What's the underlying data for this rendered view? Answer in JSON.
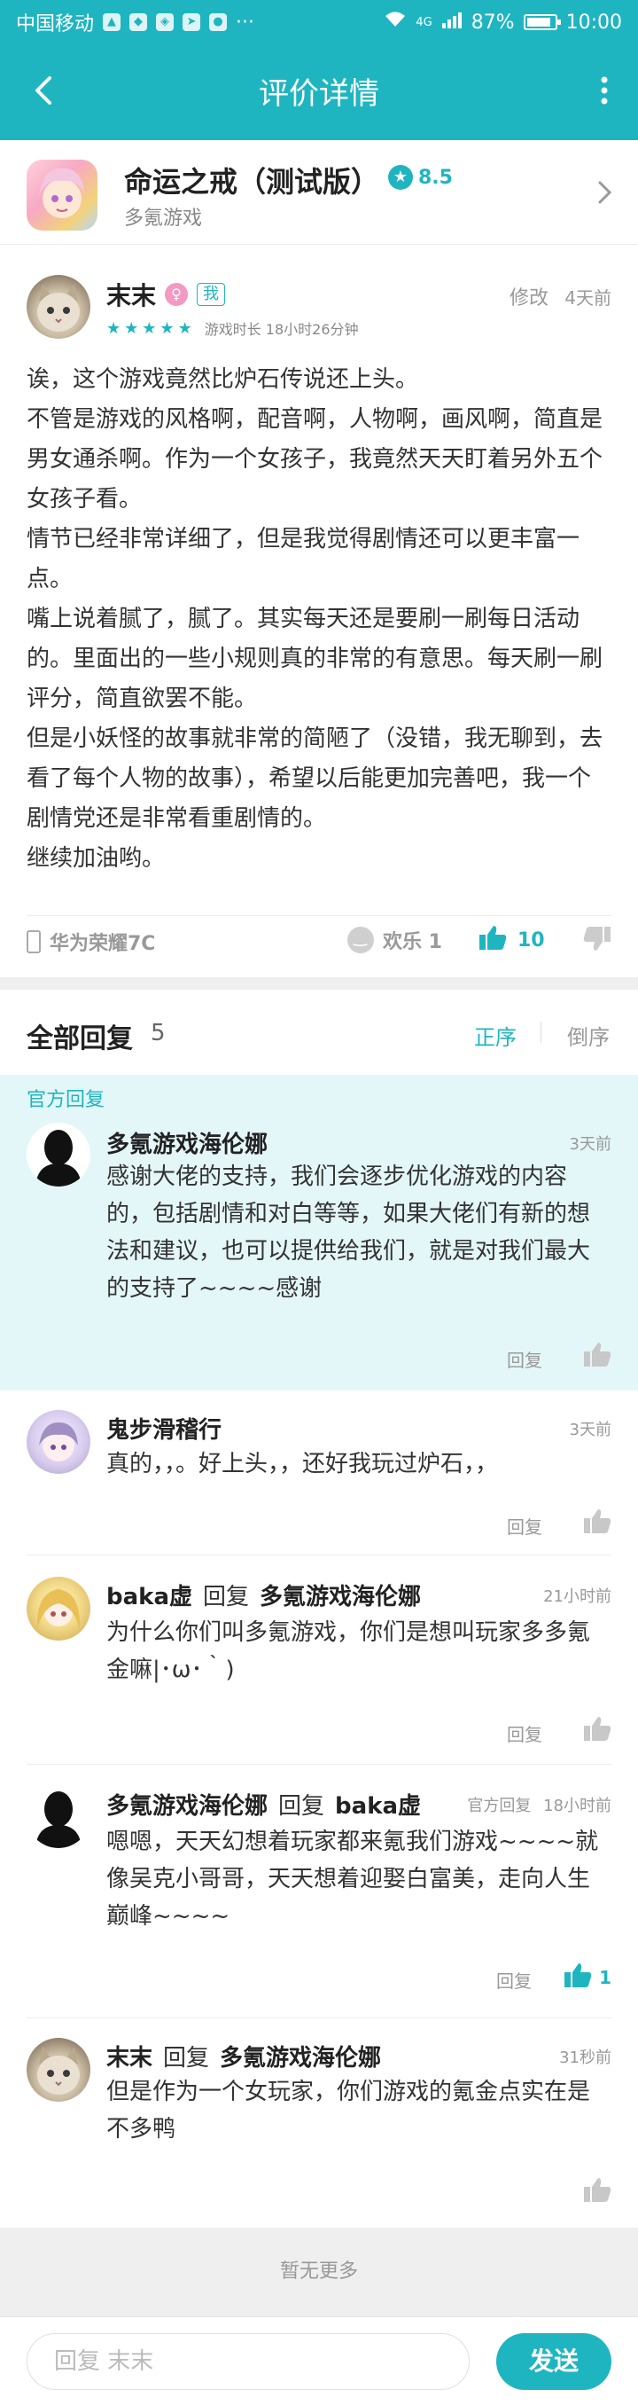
{
  "status_bar": {
    "carrier": "中国移动",
    "network": "4G",
    "battery_text": "87%",
    "battery_level": 0.87,
    "time": "10:00"
  },
  "header": {
    "title": "评价详情",
    "back_icon": "back-arrow-icon",
    "more_icon": "more-vertical-icon"
  },
  "game": {
    "name": "命运之戒（测试版）",
    "score": "8.5",
    "developer": "多氪游戏"
  },
  "review": {
    "author": "末末",
    "gender_symbol": "♀",
    "me_tag": "我",
    "stars": 5,
    "playtime": "游戏时长 18小时26分钟",
    "edit_label": "修改",
    "time": "4天前",
    "paragraphs": [
      "诶，这个游戏竟然比炉石传说还上头。",
      "不管是游戏的风格啊，配音啊，人物啊，画风啊，简直是男女通杀啊。作为一个女孩子，我竟然天天盯着另外五个女孩子看。",
      "情节已经非常详细了，但是我觉得剧情还可以更丰富一点。",
      "嘴上说着腻了，腻了。其实每天还是要刷一刷每日活动的。里面出的一些小规则真的非常的有意思。每天刷一刷评分，简直欲罢不能。",
      "但是小妖怪的故事就非常的简陋了（没错，我无聊到，去看了每个人物的故事），希望以后能更加完善吧，我一个剧情党还是非常看重剧情的。",
      "继续加油哟。"
    ],
    "device": "华为荣耀7C",
    "happy_label": "欢乐 1",
    "like_count": "10"
  },
  "replies": {
    "label": "全部回复",
    "count": "5",
    "sort_asc": "正序",
    "sort_desc": "倒序",
    "official_label": "官方回复",
    "reply_label": "回复",
    "items": [
      {
        "author": "多氪游戏海伦娜",
        "time": "3天前",
        "text": "感谢大佬的支持，我们会逐步优化游戏的内容的，包括剧情和对白等等，如果大佬们有新的想法和建议，也可以提供给我们，就是对我们最大的支持了~~~~感谢"
      },
      {
        "author": "鬼步滑稽行",
        "time": "3天前",
        "text": "真的，，。好上头，，还好我玩过炉石，，"
      },
      {
        "author": "baka虚",
        "reply_word": "回复",
        "target": "多氪游戏海伦娜",
        "time": "21小时前",
        "text": "为什么你们叫多氪游戏，你们是想叫玩家多多氪金嘛|･ω･｀)"
      },
      {
        "author": "多氪游戏海伦娜",
        "reply_word": "回复",
        "target": "baka虚",
        "official_tag": "官方回复",
        "time": "18小时前",
        "text": "嗯嗯，天天幻想着玩家都来氪我们游戏~~~~就像吴克小哥哥，天天想着迎娶白富美，走向人生巅峰~~~~",
        "likes": "1"
      },
      {
        "author": "末末",
        "reply_word": "回复",
        "target": "多氪游戏海伦娜",
        "time": "31秒前",
        "text": "但是作为一个女玩家，你们游戏的氪金点实在是不多鸭"
      }
    ],
    "no_more": "暂无更多"
  },
  "composer": {
    "placeholder": "回复 末末",
    "send_label": "发送"
  },
  "colors": {
    "brand": "#1fb5c0",
    "official_bg": "#e4f7f8",
    "divider": "#efefef"
  }
}
